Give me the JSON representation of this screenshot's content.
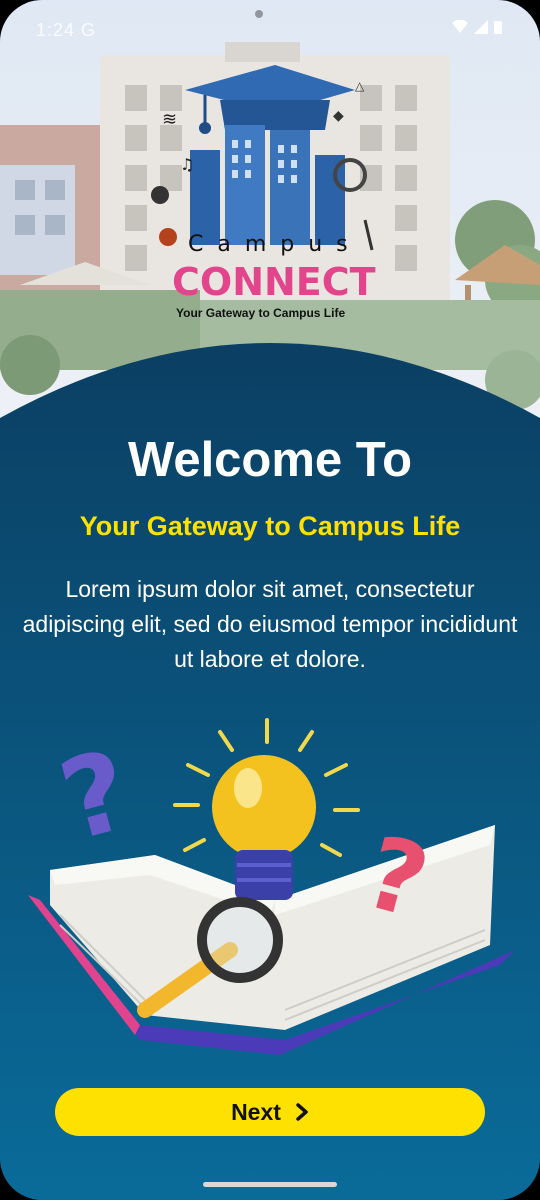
{
  "status_bar": {
    "time": "1:24 G",
    "icons": [
      "wifi-icon",
      "signal-icon",
      "battery-icon"
    ]
  },
  "logo": {
    "brand_word": "Campus",
    "brand_connect": "CONNECT",
    "logo_tagline": "Your Gateway to Campus Life"
  },
  "onboarding": {
    "title": "Welcome To",
    "subtitle": "Your Gateway to Campus Life",
    "description": "Lorem ipsum dolor sit amet, consectetur adipiscing elit, sed do eiusmod tempor incididunt ut labore et dolore."
  },
  "footer": {
    "next_label": "Next"
  },
  "colors": {
    "panel_top": "#0b3f63",
    "panel_bottom": "#0a6b99",
    "accent_yellow": "#ffe100",
    "title_white": "#ffffff"
  }
}
